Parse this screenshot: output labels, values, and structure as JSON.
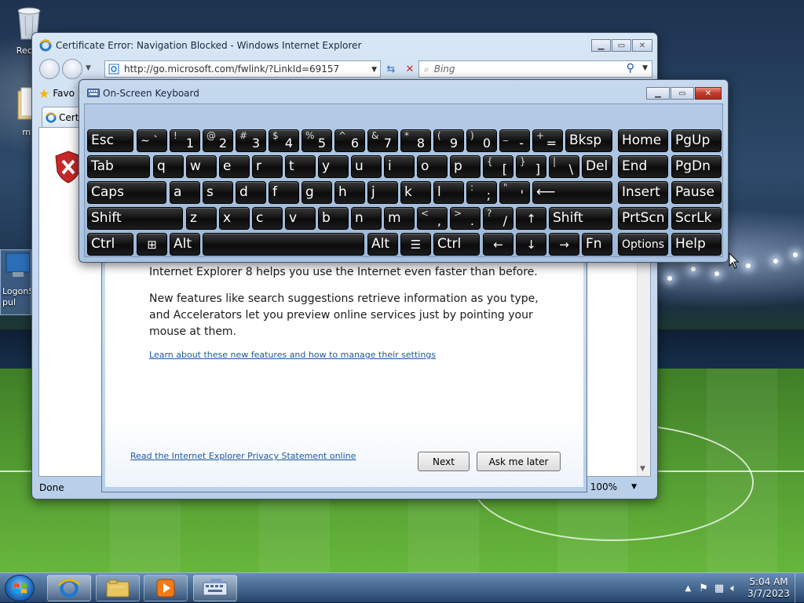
{
  "desktop": {
    "icons": [
      {
        "label": "Recyc"
      },
      {
        "label": "my"
      },
      {
        "label": "LogonS pul"
      }
    ]
  },
  "ie": {
    "title": "Certificate Error: Navigation Blocked - Windows Internet Explorer",
    "url": "http://go.microsoft.com/fwlink/?LinkId=69157",
    "search_placeholder": "Bing",
    "favorites_label": "Favo",
    "tab_label": "Cert",
    "status": "Done",
    "zoom": "100%"
  },
  "setup": {
    "line1": "Internet Explorer 8 helps you use the Internet even faster than before.",
    "line2a": "New features like search suggestions retrieve information as you type,",
    "line2b": "and Accelerators let you preview online services just by pointing your",
    "line2c": "mouse at them.",
    "learn_link": "Learn about these new features and how to manage their settings",
    "privacy_link": "Read the Internet Explorer Privacy Statement online",
    "next_button": "Next",
    "later_button": "Ask me later"
  },
  "osk": {
    "title": "On-Screen Keyboard",
    "keys": {
      "esc": "Esc",
      "bksp": "Bksp",
      "home": "Home",
      "pgup": "PgUp",
      "tab": "Tab",
      "del": "Del",
      "end": "End",
      "pgdn": "PgDn",
      "caps": "Caps",
      "insert": "Insert",
      "pause": "Pause",
      "shift": "Shift",
      "prtscn": "PrtScn",
      "scrlk": "ScrLk",
      "ctrl": "Ctrl",
      "alt": "Alt",
      "fn": "Fn",
      "options": "Options",
      "help": "Help",
      "enter_glyph": "⟵",
      "up": "↑",
      "left": "←",
      "down": "↓",
      "right": "→"
    },
    "row1": [
      {
        "s": "~",
        "m": "`"
      },
      {
        "s": "!",
        "m": "1"
      },
      {
        "s": "@",
        "m": "2"
      },
      {
        "s": "#",
        "m": "3"
      },
      {
        "s": "$",
        "m": "4"
      },
      {
        "s": "%",
        "m": "5"
      },
      {
        "s": "^",
        "m": "6"
      },
      {
        "s": "&",
        "m": "7"
      },
      {
        "s": "*",
        "m": "8"
      },
      {
        "s": "(",
        "m": "9"
      },
      {
        "s": ")",
        "m": "0"
      },
      {
        "s": "_",
        "m": "-"
      },
      {
        "s": "+",
        "m": "="
      }
    ],
    "row2": [
      {
        "m": "q"
      },
      {
        "m": "w"
      },
      {
        "m": "e"
      },
      {
        "m": "r"
      },
      {
        "m": "t"
      },
      {
        "m": "y"
      },
      {
        "m": "u"
      },
      {
        "m": "i"
      },
      {
        "m": "o"
      },
      {
        "m": "p"
      },
      {
        "s": "{",
        "m": "["
      },
      {
        "s": "}",
        "m": "]"
      },
      {
        "s": "|",
        "m": "\\"
      }
    ],
    "row3": [
      {
        "m": "a"
      },
      {
        "m": "s"
      },
      {
        "m": "d"
      },
      {
        "m": "f"
      },
      {
        "m": "g"
      },
      {
        "m": "h"
      },
      {
        "m": "j"
      },
      {
        "m": "k"
      },
      {
        "m": "l"
      },
      {
        "s": ":",
        "m": ";"
      },
      {
        "s": "\"",
        "m": "'"
      }
    ],
    "row4": [
      {
        "m": "z"
      },
      {
        "m": "x"
      },
      {
        "m": "c"
      },
      {
        "m": "v"
      },
      {
        "m": "b"
      },
      {
        "m": "n"
      },
      {
        "m": "m"
      },
      {
        "s": "<",
        "m": ","
      },
      {
        "s": ">",
        "m": "."
      },
      {
        "s": "?",
        "m": "/"
      }
    ]
  },
  "taskbar": {
    "time": "5:04 AM",
    "date": "3/7/2023"
  },
  "colors": {
    "accent": "#1c57a5",
    "close_red": "#c0392b"
  }
}
